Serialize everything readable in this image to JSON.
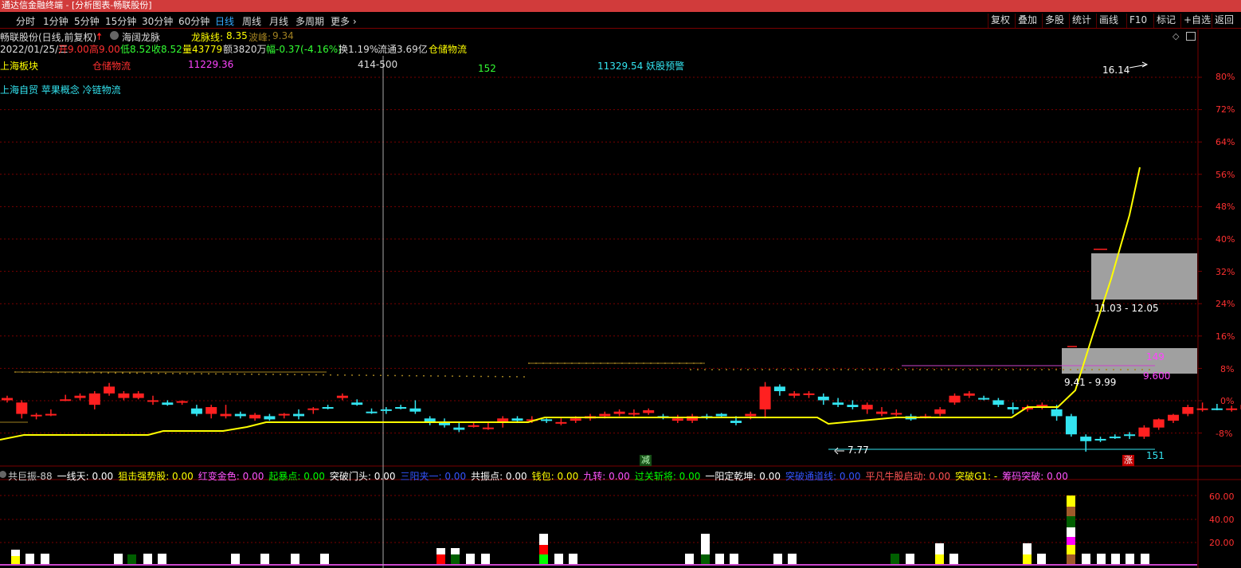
{
  "window": {
    "title": "通达信金融终端 - [分析图表-畅联股份]"
  },
  "periods": [
    "分时",
    "1分钟",
    "5分钟",
    "15分钟",
    "30分钟",
    "60分钟",
    "日线",
    "周线",
    "月线",
    "多周期",
    "更多"
  ],
  "active_period": "日线",
  "right_buttons": [
    "复权",
    "叠加",
    "多股",
    "统计",
    "画线",
    "F10",
    "标记",
    "+自选",
    "返回"
  ],
  "header": {
    "stock": "畅联股份(日线,前复权)",
    "indicator": "海阔龙脉",
    "longmai_label": "龙脉线:",
    "longmai_value": "8.35",
    "bofeng_label": "波峰:",
    "bofeng_value": "9.34"
  },
  "quote": {
    "date": "2022/01/25/二",
    "open": "开9.00",
    "high": "高9.00",
    "low": "低8.52",
    "close": "收8.52",
    "volume": "量43779",
    "amount": "额3820万",
    "change": "幅-0.37(-4.16%)",
    "turnover": "换1.19%",
    "float_cap": "流通3.69亿",
    "sector": "仓储物流"
  },
  "row3": {
    "a": "上海板块",
    "b": "仓储物流",
    "c": "11229.36",
    "d": "414-500",
    "e": "152",
    "f": "11329.54 妖股预警"
  },
  "concepts": "上海自贸 苹果概念 冷链物流",
  "chart_labels": {
    "high_price": "16.14",
    "box_upper": "11.03 - 12.05",
    "box_lower": "9.41 - 9.99",
    "low_price": "7.77",
    "box_val1": "149",
    "box_val2": "9.600",
    "jian": "减",
    "zhang": "涨",
    "bottom_val": "151"
  },
  "y_axis_labels": [
    "80%",
    "72%",
    "64%",
    "56%",
    "48%",
    "40%",
    "32%",
    "24%",
    "16%",
    "8%",
    "0%",
    "-8%"
  ],
  "lower_axis_labels": [
    "60.00",
    "40.00",
    "20.00"
  ],
  "indicators": [
    {
      "text": "共巨振-88",
      "color": "#cccccc"
    },
    {
      "text": "一线天: 0.00",
      "color": "#ffffff"
    },
    {
      "text": "狙击强势股: 0.00",
      "color": "#ffff00"
    },
    {
      "text": "红变金色: 0.00",
      "color": "#ff55ff"
    },
    {
      "text": "起暴点: 0.00",
      "color": "#00ff00"
    },
    {
      "text": "突破门头: 0.00",
      "color": "#ffffff"
    },
    {
      "text": "三阳夹一: 0.00",
      "color": "#3355ff"
    },
    {
      "text": "共振点: 0.00",
      "color": "#ffffff"
    },
    {
      "text": "钱包: 0.00",
      "color": "#ffff00"
    },
    {
      "text": "九转: 0.00",
      "color": "#ff55ff"
    },
    {
      "text": "过关斩将: 0.00",
      "color": "#00ff00"
    },
    {
      "text": "一阳定乾坤: 0.00",
      "color": "#ffffff"
    },
    {
      "text": "突破通道线: 0.00",
      "color": "#3355ff"
    },
    {
      "text": "平凡牛股启动: 0.00",
      "color": "#ff5555"
    },
    {
      "text": "突破G1: -",
      "color": "#ffff00"
    },
    {
      "text": "筹码突破: 0.00",
      "color": "#ff55ff"
    }
  ],
  "colors": {
    "up": "#ff2020",
    "down": "#33e4f0",
    "ma_line": "#ffff00",
    "dotted_line": "#a08020",
    "magenta": "#cc44cc",
    "grid": "#7a0000",
    "box": "#a0a0a0",
    "accent_red": "#d13b3b"
  },
  "chart_data": {
    "type": "candlestick",
    "y_axis_unit": "%",
    "y_labels": [
      "80%",
      "72%",
      "64%",
      "56%",
      "48%",
      "40%",
      "32%",
      "24%",
      "16%",
      "8%",
      "0%",
      "-8%"
    ],
    "candles": [
      [
        8.9,
        9.0,
        8.85,
        8.95
      ],
      [
        8.6,
        8.9,
        8.5,
        8.85
      ],
      [
        8.55,
        8.62,
        8.48,
        8.58
      ],
      [
        8.58,
        8.7,
        8.55,
        8.6
      ],
      [
        8.9,
        9.02,
        8.88,
        8.92
      ],
      [
        8.95,
        9.05,
        8.9,
        9.0
      ],
      [
        8.8,
        9.1,
        8.7,
        9.05
      ],
      [
        9.05,
        9.28,
        9.0,
        9.2
      ],
      [
        8.95,
        9.1,
        8.9,
        9.05
      ],
      [
        8.95,
        9.1,
        8.92,
        9.05
      ],
      [
        8.9,
        9.0,
        8.8,
        8.9
      ],
      [
        8.85,
        8.9,
        8.78,
        8.8
      ],
      [
        8.85,
        8.9,
        8.8,
        8.88
      ],
      [
        8.72,
        8.8,
        8.55,
        8.6
      ],
      [
        8.6,
        8.8,
        8.5,
        8.75
      ],
      [
        8.55,
        8.8,
        8.5,
        8.6
      ],
      [
        8.6,
        8.65,
        8.5,
        8.55
      ],
      [
        8.5,
        8.62,
        8.45,
        8.58
      ],
      [
        8.55,
        8.6,
        8.45,
        8.48
      ],
      [
        8.58,
        8.62,
        8.5,
        8.6
      ],
      [
        8.6,
        8.7,
        8.48,
        8.55
      ],
      [
        8.7,
        8.75,
        8.6,
        8.72
      ],
      [
        8.75,
        8.8,
        8.7,
        8.72
      ],
      [
        8.95,
        9.05,
        8.9,
        9.0
      ],
      [
        8.85,
        8.92,
        8.78,
        8.8
      ],
      [
        8.65,
        8.72,
        8.6,
        8.62
      ],
      [
        8.7,
        8.75,
        8.6,
        8.68
      ],
      [
        8.75,
        8.8,
        8.7,
        8.72
      ],
      [
        8.72,
        8.9,
        8.6,
        8.65
      ],
      [
        8.5,
        8.55,
        8.35,
        8.4
      ],
      [
        8.4,
        8.5,
        8.3,
        8.35
      ],
      [
        8.3,
        8.4,
        8.2,
        8.25
      ],
      [
        8.35,
        8.42,
        8.3,
        8.35
      ],
      [
        8.3,
        8.4,
        8.25,
        8.3
      ],
      [
        8.4,
        8.55,
        8.3,
        8.5
      ],
      [
        8.5,
        8.55,
        8.4,
        8.45
      ],
      [
        8.45,
        8.55,
        8.4,
        8.48
      ],
      [
        8.48,
        8.5,
        8.4,
        8.45
      ],
      [
        8.4,
        8.5,
        8.35,
        8.42
      ],
      [
        8.45,
        8.55,
        8.4,
        8.5
      ],
      [
        8.5,
        8.6,
        8.45,
        8.55
      ],
      [
        8.55,
        8.65,
        8.5,
        8.6
      ],
      [
        8.6,
        8.7,
        8.55,
        8.65
      ],
      [
        8.6,
        8.7,
        8.55,
        8.62
      ],
      [
        8.62,
        8.72,
        8.58,
        8.68
      ],
      [
        8.55,
        8.6,
        8.48,
        8.52
      ],
      [
        8.45,
        8.58,
        8.4,
        8.5
      ],
      [
        8.45,
        8.6,
        8.4,
        8.55
      ],
      [
        8.55,
        8.6,
        8.48,
        8.52
      ],
      [
        8.6,
        8.62,
        8.52,
        8.55
      ],
      [
        8.45,
        8.55,
        8.35,
        8.4
      ],
      [
        8.55,
        8.65,
        8.48,
        8.6
      ],
      [
        8.7,
        9.3,
        8.5,
        9.2
      ],
      [
        9.2,
        9.25,
        9.0,
        9.1
      ],
      [
        9.0,
        9.1,
        8.95,
        9.05
      ],
      [
        9.02,
        9.1,
        8.95,
        9.05
      ],
      [
        8.98,
        9.05,
        8.8,
        8.9
      ],
      [
        8.85,
        8.95,
        8.75,
        8.8
      ],
      [
        8.8,
        8.9,
        8.7,
        8.75
      ],
      [
        8.7,
        8.85,
        8.6,
        8.8
      ],
      [
        8.6,
        8.75,
        8.55,
        8.65
      ],
      [
        8.6,
        8.7,
        8.55,
        8.62
      ],
      [
        8.55,
        8.6,
        8.45,
        8.48
      ],
      [
        8.55,
        8.6,
        8.5,
        8.55
      ],
      [
        8.6,
        8.75,
        8.55,
        8.7
      ],
      [
        8.85,
        9.05,
        8.8,
        9.0
      ],
      [
        9.0,
        9.1,
        8.95,
        9.05
      ],
      [
        8.95,
        9.0,
        8.9,
        8.92
      ],
      [
        8.9,
        8.95,
        8.75,
        8.8
      ],
      [
        8.75,
        8.85,
        8.6,
        8.7
      ],
      [
        8.7,
        8.8,
        8.65,
        8.75
      ],
      [
        8.75,
        8.85,
        8.7,
        8.8
      ],
      [
        8.7,
        8.8,
        8.45,
        8.55
      ],
      [
        8.55,
        8.6,
        8.1,
        8.15
      ],
      [
        8.1,
        8.15,
        7.77,
        8.0
      ],
      [
        8.05,
        8.1,
        7.98,
        8.02
      ],
      [
        8.1,
        8.15,
        8.05,
        8.08
      ],
      [
        8.15,
        8.2,
        8.05,
        8.12
      ],
      [
        8.1,
        8.35,
        8.05,
        8.3
      ],
      [
        8.3,
        8.5,
        8.25,
        8.48
      ],
      [
        8.45,
        8.6,
        8.4,
        8.58
      ],
      [
        8.6,
        8.8,
        8.55,
        8.75
      ],
      [
        8.7,
        8.85,
        8.65,
        8.72
      ],
      [
        8.72,
        8.82,
        8.68,
        8.7
      ],
      [
        8.7,
        8.78,
        8.65,
        8.72
      ],
      [
        8.7,
        8.85,
        8.6,
        8.8
      ],
      [
        8.8,
        8.9,
        8.75,
        8.85
      ],
      [
        8.8,
        8.9,
        8.75,
        8.85
      ],
      [
        8.85,
        8.95,
        8.8,
        8.88
      ],
      [
        8.85,
        9.2,
        8.8,
        9.15
      ],
      [
        9.1,
        9.15,
        8.9,
        8.95
      ],
      [
        8.9,
        9.0,
        8.8,
        8.95
      ],
      [
        9.9,
        10.5,
        9.4,
        9.95
      ],
      [
        10.95,
        11.05,
        10.8,
        11.0
      ],
      [
        11.05,
        12.05,
        11.0,
        12.0
      ],
      [
        12.05,
        13.2,
        11.9,
        13.15
      ],
      [
        13.2,
        14.5,
        13.0,
        14.4
      ],
      [
        14.4,
        15.9,
        14.3,
        15.8
      ],
      [
        15.8,
        16.14,
        15.4,
        16.1
      ]
    ]
  }
}
